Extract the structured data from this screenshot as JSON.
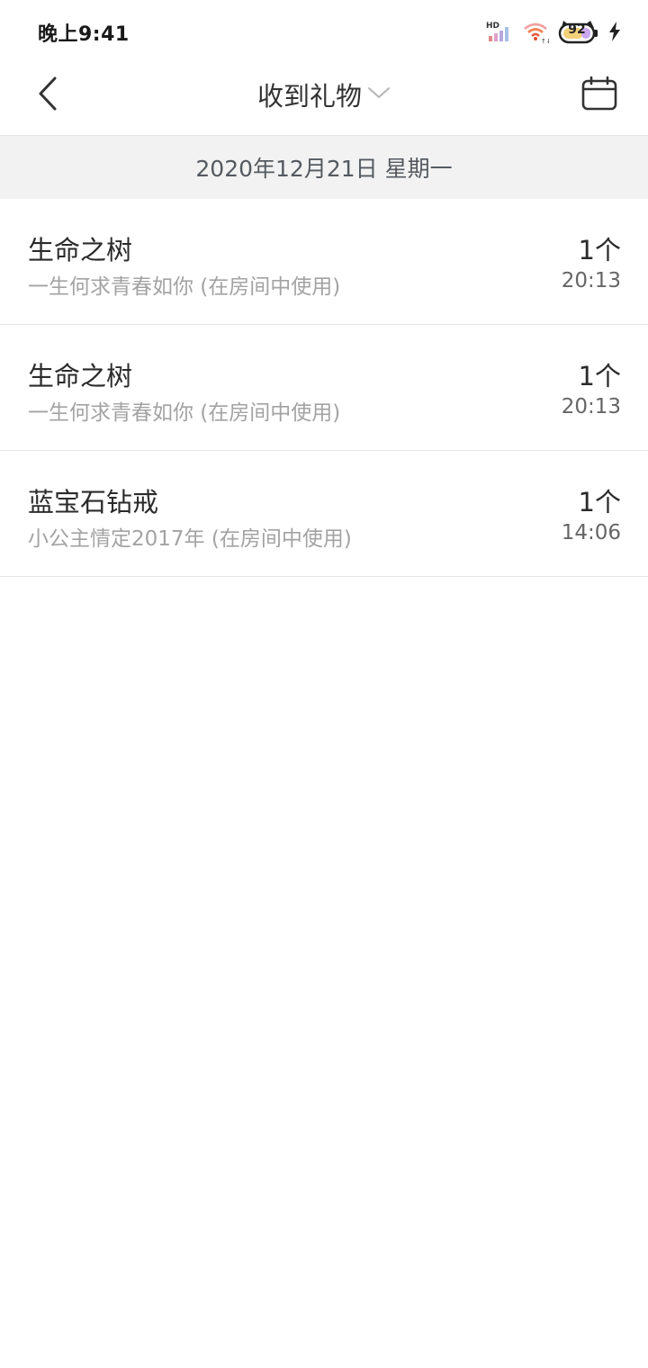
{
  "status_bar": {
    "time": "晚上9:41",
    "hd_label": "HD",
    "battery_level": "92",
    "icons": [
      "signal-icon",
      "wifi-icon",
      "battery-icon",
      "charging-bolt-icon"
    ]
  },
  "header": {
    "title": "收到礼物",
    "icons": [
      "back-chevron-icon",
      "chevron-down-icon",
      "calendar-icon"
    ]
  },
  "date_section": {
    "label": "2020年12月21日 星期一"
  },
  "gifts": [
    {
      "name": "生命之树",
      "description": "一生何求青春如你 (在房间中使用)",
      "count": "1个",
      "time": "20:13"
    },
    {
      "name": "生命之树",
      "description": "一生何求青春如你 (在房间中使用)",
      "count": "1个",
      "time": "20:13"
    },
    {
      "name": "蓝宝石钻戒",
      "description": "小公主情定2017年 (在房间中使用)",
      "count": "1个",
      "time": "14:06"
    }
  ],
  "colors": {
    "date_bar_bg": "#f2f2f2",
    "primary_text": "#2b2b2b",
    "secondary_text": "#a3a3a3",
    "divider": "#e5e5e5"
  }
}
